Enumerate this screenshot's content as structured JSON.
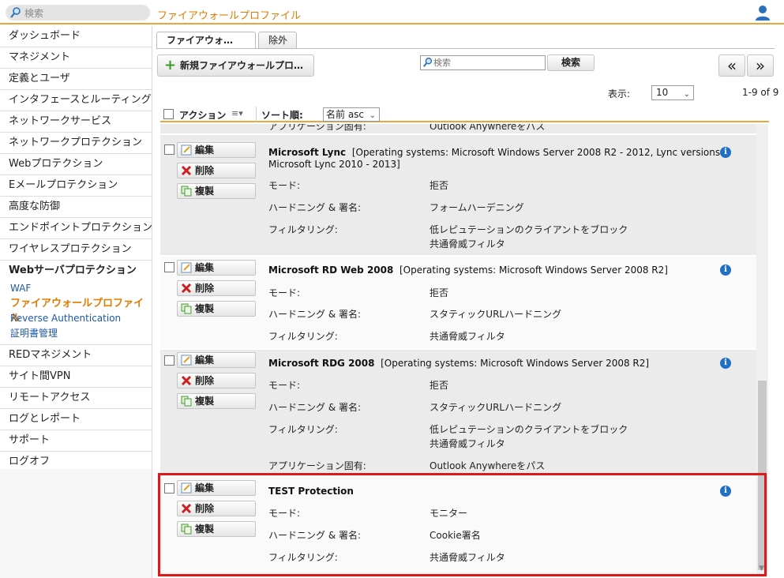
{
  "topbar": {
    "search_placeholder": "検索",
    "page_title": "ファイアウォールプロファイル"
  },
  "icons": {
    "search": "search-icon",
    "user": "user-icon",
    "info": "info-icon",
    "edit": "edit-icon",
    "delete": "delete-icon",
    "clone": "clone-icon"
  },
  "colors": {
    "accent": "#e07b00",
    "link": "#1a5aa8",
    "highlight": "#e01818",
    "info": "#1f6fc4"
  },
  "sidebar": {
    "items_top": [
      "ダッシュボード",
      "マネジメント",
      "定義とユーザ",
      "インタフェースとルーティング",
      "ネットワークサービス",
      "ネットワークプロテクション",
      "Webプロテクション",
      "Eメールプロテクション",
      "高度な防御",
      "エンドポイントプロテクション",
      "ワイヤレスプロテクション"
    ],
    "group_head": "Webサーバプロテクション",
    "group_items": [
      "WAF",
      "ファイアウォールプロファイル",
      "Reverse Authentication",
      "証明書管理"
    ],
    "items_bottom": [
      "REDマネジメント",
      "サイト間VPN",
      "リモートアクセス",
      "ログとレポート",
      "サポート",
      "ログオフ"
    ]
  },
  "tabs": [
    "ファイアウォ…",
    "除外"
  ],
  "toolbar": {
    "new_label": "新規ファイアウォールプロ…",
    "search_placeholder": "検索",
    "search_button": "検索",
    "prev": "«",
    "next": "»"
  },
  "display": {
    "label": "表示:",
    "value": "10",
    "count": "1-9 of 9"
  },
  "list_header": {
    "action": "アクション",
    "sort_label": "ソート順:",
    "sort_value": "名前 asc"
  },
  "actions": {
    "edit": "編集",
    "delete": "削除",
    "clone": "複製"
  },
  "partial_row": {
    "key": "アプリケーション固有:",
    "value": "Outlook Anywhereをパス"
  },
  "rows": [
    {
      "title": "Microsoft Lync",
      "desc": "[Operating systems: Microsoft Windows Server 2008 R2 - 2012, Lync versions:",
      "desc2": "Microsoft Lync 2010 - 2013]",
      "mode_k": "モード:",
      "mode_v": "拒否",
      "hard_k": "ハードニング & 署名:",
      "hard_v": "フォームハーデニング",
      "filt_k": "フィルタリング:",
      "filt_v1": "低レピュテーションのクライアントをブロック",
      "filt_v2": "共通脅威フィルタ"
    },
    {
      "title": "Microsoft RD Web 2008",
      "desc": "[Operating systems: Microsoft Windows Server 2008 R2]",
      "mode_k": "モード:",
      "mode_v": "拒否",
      "hard_k": "ハードニング & 署名:",
      "hard_v": "スタティックURLハードニング",
      "filt_k": "フィルタリング:",
      "filt_v1": "共通脅威フィルタ"
    },
    {
      "title": "Microsoft RDG 2008",
      "desc": "[Operating systems: Microsoft Windows Server 2008 R2]",
      "mode_k": "モード:",
      "mode_v": "拒否",
      "hard_k": "ハードニング & 署名:",
      "hard_v": "スタティックURLハードニング",
      "filt_k": "フィルタリング:",
      "filt_v1": "低レピュテーションのクライアントをブロック",
      "filt_v2": "共通脅威フィルタ",
      "app_k": "アプリケーション固有:",
      "app_v": "Outlook Anywhereをパス"
    },
    {
      "title": "TEST Protection",
      "mode_k": "モード:",
      "mode_v": "モニター",
      "hard_k": "ハードニング & 署名:",
      "hard_v": "Cookie署名",
      "filt_k": "フィルタリング:",
      "filt_v1": "共通脅威フィルタ"
    }
  ]
}
